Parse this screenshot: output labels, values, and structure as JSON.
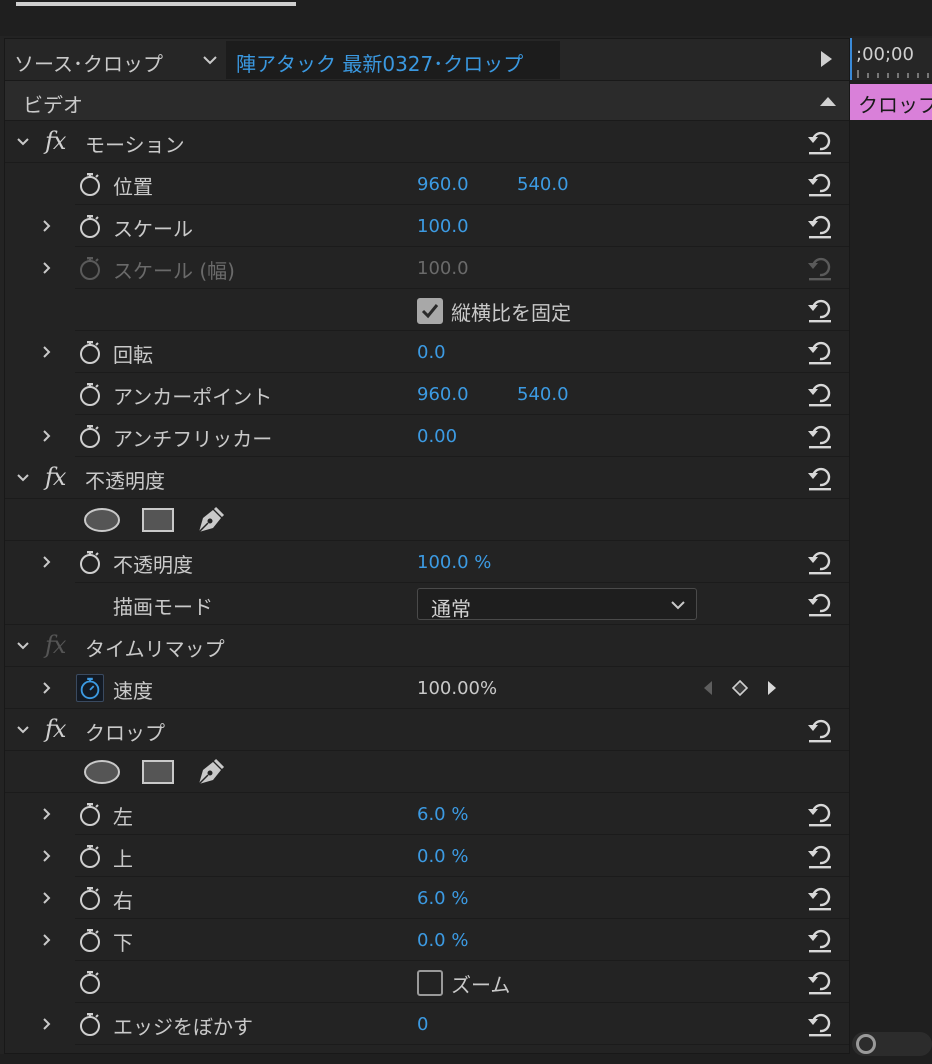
{
  "header": {
    "source_label": "ソース･クロップ",
    "clip_name": "陣アタック 最新0327･クロップ"
  },
  "section": {
    "label": "ビデオ"
  },
  "timeline": {
    "timecode": ";00;00",
    "clip_label": "クロップ"
  },
  "effects": {
    "motion": {
      "name": "モーション",
      "position": {
        "label": "位置",
        "x": "960.0",
        "y": "540.0"
      },
      "scale": {
        "label": "スケール",
        "value": "100.0"
      },
      "scale_width": {
        "label": "スケール (幅)",
        "value": "100.0"
      },
      "uniform_scale": {
        "label": "縦横比を固定",
        "checked": true
      },
      "rotation": {
        "label": "回転",
        "value": "0.0"
      },
      "anchor": {
        "label": "アンカーポイント",
        "x": "960.0",
        "y": "540.0"
      },
      "anti_flicker": {
        "label": "アンチフリッカー",
        "value": "0.00"
      }
    },
    "opacity": {
      "name": "不透明度",
      "opacity": {
        "label": "不透明度",
        "value": "100.0 %"
      },
      "blend_mode": {
        "label": "描画モード",
        "value": "通常"
      }
    },
    "time_remap": {
      "name": "タイムリマップ",
      "speed": {
        "label": "速度",
        "value": "100.00%"
      }
    },
    "crop": {
      "name": "クロップ",
      "left": {
        "label": "左",
        "value": "6.0 %"
      },
      "top": {
        "label": "上",
        "value": "0.0 %"
      },
      "right": {
        "label": "右",
        "value": "6.0 %"
      },
      "bottom": {
        "label": "下",
        "value": "0.0 %"
      },
      "zoom": {
        "label": "ズーム",
        "checked": false
      },
      "feather": {
        "label": "エッジをぼかす",
        "value": "0"
      }
    }
  },
  "colors": {
    "value_blue": "#3c9ae2",
    "clip_pink": "#d980d9",
    "panel_bg": "#232323"
  },
  "icons": {
    "stopwatch": "stopwatch-icon",
    "reset": "reset-icon",
    "fx": "fx-badge",
    "mask_ellipse": "ellipse-mask-icon",
    "mask_rect": "rectangle-mask-icon",
    "mask_pen": "pen-mask-icon"
  }
}
